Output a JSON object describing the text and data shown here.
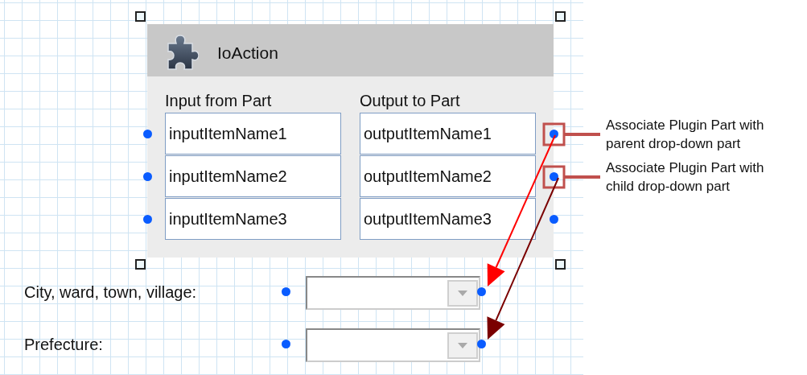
{
  "plugin_part": {
    "title": "IoAction",
    "input_heading": "Input from Part",
    "output_heading": "Output to Part",
    "inputs": [
      "inputItemName1",
      "inputItemName2",
      "inputItemName3"
    ],
    "outputs": [
      "outputItemName1",
      "outputItemName2",
      "outputItemName3"
    ]
  },
  "form_fields": [
    {
      "label": "City, ward, town, village:"
    },
    {
      "label": "Prefecture:"
    }
  ],
  "connections": [
    {
      "color": "#ff0000"
    },
    {
      "color": "#7a0000"
    }
  ],
  "annotations": [
    {
      "lines": [
        "Associate Plugin Part with",
        "parent drop-down part"
      ]
    },
    {
      "lines": [
        "Associate Plugin Part with",
        "child drop-down part"
      ]
    }
  ]
}
